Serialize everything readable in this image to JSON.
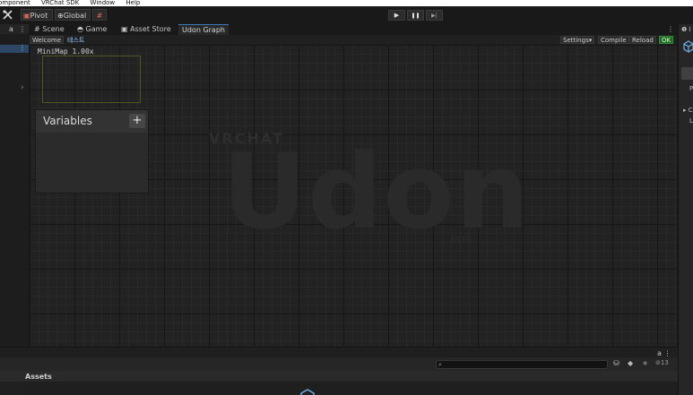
{
  "menubar": {
    "items": [
      "omponent",
      "VRChat SDK",
      "Window",
      "Help"
    ]
  },
  "toolbar": {
    "tool_icon": "tools-icon",
    "pivot_label": "Pivot",
    "global_label": "Global",
    "grid_icon": "grid-snap-icon",
    "play_icon": "▶",
    "pause_icon": "❚❚",
    "step_icon": "▶|"
  },
  "left_dock": {
    "lock": "a",
    "menu": "⋮",
    "menu2": "⋮",
    "chevron": "›"
  },
  "center_tabs": {
    "menu": "⋮",
    "tabs": [
      {
        "label": "Scene",
        "icon": "#"
      },
      {
        "label": "Game",
        "icon": "◓"
      },
      {
        "label": "Asset Store",
        "icon": "▣"
      },
      {
        "label": "Udon Graph",
        "active": true
      }
    ]
  },
  "udon_toolbar": {
    "welcome": "Welcome",
    "breadcrumb": "테스트",
    "settings": "Settings▾",
    "compile": "Compile",
    "reload": "Reload",
    "ok": "OK",
    "ok_color": "#1f6b22"
  },
  "graph": {
    "minimap_label": "MiniMap 1.00x",
    "watermark_small": "VRCHAT",
    "watermark_big": "Udon",
    "watermark_tiny": "BETA",
    "variables_title": "Variables",
    "variables_add": "+"
  },
  "right_dock": {
    "info": "❶ I",
    "row1": "P",
    "row2": "▸ C",
    "row3": "L"
  },
  "bottom": {
    "lock": "a ⋮",
    "search_icon": "⌕",
    "hidden_count": "13",
    "assets_label": "Assets"
  },
  "colors": {
    "accent": "#3a79bb",
    "selection": "#2d4867",
    "minimap_border": "#4f5621"
  }
}
